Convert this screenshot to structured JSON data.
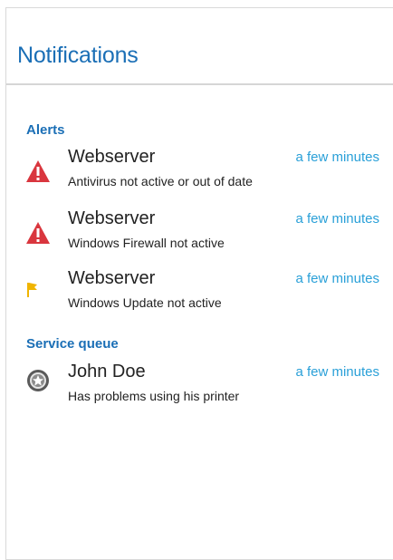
{
  "header": {
    "title": "Notifications"
  },
  "alerts": {
    "heading": "Alerts",
    "items": [
      {
        "icon": "warning-triangle-icon",
        "title": "Webserver",
        "description": "Antivirus not active or out of date",
        "time": "a few minutes"
      },
      {
        "icon": "warning-triangle-icon",
        "title": "Webserver",
        "description": "Windows Firewall not active",
        "time": "a few minutes"
      },
      {
        "icon": "flag-icon",
        "title": "Webserver",
        "description": "Windows Update not active",
        "time": "a few minutes"
      }
    ]
  },
  "service_queue": {
    "heading": "Service queue",
    "items": [
      {
        "icon": "user-avatar-icon",
        "title": "John Doe",
        "description": "Has problems using his printer",
        "time": "a few minutes"
      }
    ]
  },
  "colors": {
    "accent": "#1b6fb6",
    "link": "#2aa0d8",
    "alert_red": "#d9363e",
    "flag_yellow": "#f0b400"
  }
}
